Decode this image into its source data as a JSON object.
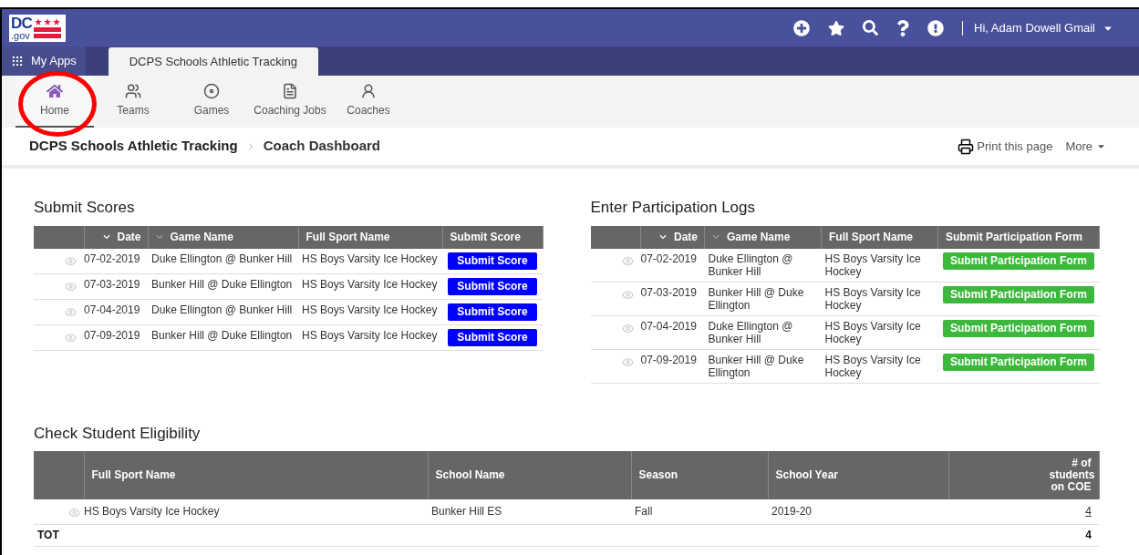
{
  "header": {
    "logo": {
      "top": "DC",
      "bottom": ".gov"
    },
    "user": "Hi, Adam Dowell Gmail"
  },
  "app_tabs": [
    {
      "label": "My Apps",
      "kind": "launcher",
      "selected": false
    },
    {
      "label": "DCPS Schools Athletic Tracking",
      "kind": "tab",
      "selected": true
    }
  ],
  "nav": [
    {
      "label": "Home",
      "selected": true
    },
    {
      "label": "Teams",
      "selected": false
    },
    {
      "label": "Games",
      "selected": false
    },
    {
      "label": "Coaching Jobs",
      "selected": false
    },
    {
      "label": "Coaches",
      "selected": false
    }
  ],
  "breadcrumb": [
    "DCPS Schools Athletic Tracking",
    "Coach Dashboard"
  ],
  "page_actions": {
    "print": "Print this page",
    "more": "More"
  },
  "submit_scores": {
    "title": "Submit Scores",
    "columns": [
      {
        "label": "Date",
        "sortable": true,
        "sorted": true
      },
      {
        "label": "Game Name",
        "sortable": true,
        "sorted": false
      },
      {
        "label": "Full Sport Name",
        "sortable": false,
        "sorted": false
      },
      {
        "label": "Submit Score",
        "sortable": false,
        "sorted": false
      }
    ],
    "rows": [
      {
        "date": "07-02-2019",
        "game": "Duke Ellington @ Bunker Hill",
        "sport": "HS Boys Varsity Ice Hockey",
        "action": "Submit Score"
      },
      {
        "date": "07-03-2019",
        "game": "Bunker Hill @ Duke Ellington",
        "sport": "HS Boys Varsity Ice Hockey",
        "action": "Submit Score"
      },
      {
        "date": "07-04-2019",
        "game": "Duke Ellington @ Bunker Hill",
        "sport": "HS Boys Varsity Ice Hockey",
        "action": "Submit Score"
      },
      {
        "date": "07-09-2019",
        "game": "Bunker Hill @ Duke Ellington",
        "sport": "HS Boys Varsity Ice Hockey",
        "action": "Submit Score"
      }
    ]
  },
  "participation_logs": {
    "title": "Enter Participation Logs",
    "columns": [
      {
        "label": "Date",
        "sortable": true,
        "sorted": true
      },
      {
        "label": "Game Name",
        "sortable": true,
        "sorted": false
      },
      {
        "label": "Full Sport Name",
        "sortable": false,
        "sorted": false
      },
      {
        "label": "Submit Participation Form",
        "sortable": false,
        "sorted": false
      }
    ],
    "rows": [
      {
        "date": "07-02-2019",
        "game": "Duke Ellington @ Bunker Hill",
        "sport": "HS Boys Varsity Ice Hockey",
        "action": "Submit Participation Form"
      },
      {
        "date": "07-03-2019",
        "game": "Bunker Hill @ Duke Ellington",
        "sport": "HS Boys Varsity Ice Hockey",
        "action": "Submit Participation Form"
      },
      {
        "date": "07-04-2019",
        "game": "Duke Ellington @ Bunker Hill",
        "sport": "HS Boys Varsity Ice Hockey",
        "action": "Submit Participation Form"
      },
      {
        "date": "07-09-2019",
        "game": "Bunker Hill @ Duke Ellington",
        "sport": "HS Boys Varsity Ice Hockey",
        "action": "Submit Participation Form"
      }
    ]
  },
  "eligibility": {
    "title": "Check Student Eligibility",
    "columns": [
      "Full Sport Name",
      "School Name",
      "Season",
      "School Year",
      "# of students on COE"
    ],
    "rows": [
      {
        "sport": "HS Boys Varsity Ice Hockey",
        "school": "Bunker Hill ES",
        "season": "Fall",
        "year": "2019-20",
        "count": "4"
      }
    ],
    "total": {
      "label": "TOT",
      "count": "4"
    }
  }
}
